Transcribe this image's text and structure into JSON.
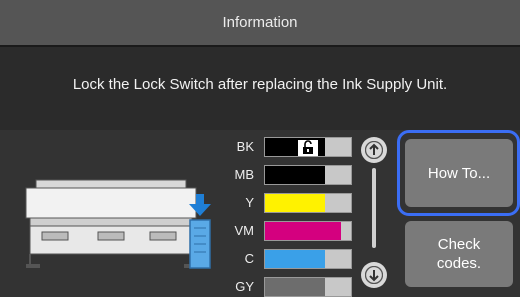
{
  "header": {
    "title": "Information"
  },
  "message": "Lock the Lock Switch after replacing the Ink Supply Unit.",
  "inks": [
    {
      "label": "BK",
      "color": "#000000",
      "level": 0.7,
      "locked": true
    },
    {
      "label": "MB",
      "color": "#000000",
      "level": 0.7
    },
    {
      "label": "Y",
      "color": "#fff200",
      "level": 0.7
    },
    {
      "label": "VM",
      "color": "#d4007f",
      "level": 0.88
    },
    {
      "label": "C",
      "color": "#3aa0e8",
      "level": 0.7
    },
    {
      "label": "GY",
      "color": "#6d6d6d",
      "level": 0.7
    }
  ],
  "buttons": {
    "how_to": "How To...",
    "check_codes_line1": "Check",
    "check_codes_line2": "codes."
  },
  "icons": {
    "scroll_up": "arrow-up-icon",
    "scroll_down": "arrow-down-icon",
    "lock": "lock-icon",
    "insert_arrow": "down-arrow-icon"
  },
  "colors": {
    "focus": "#3b6ef5",
    "button": "#7a7a7a",
    "title_bar": "#555555"
  }
}
